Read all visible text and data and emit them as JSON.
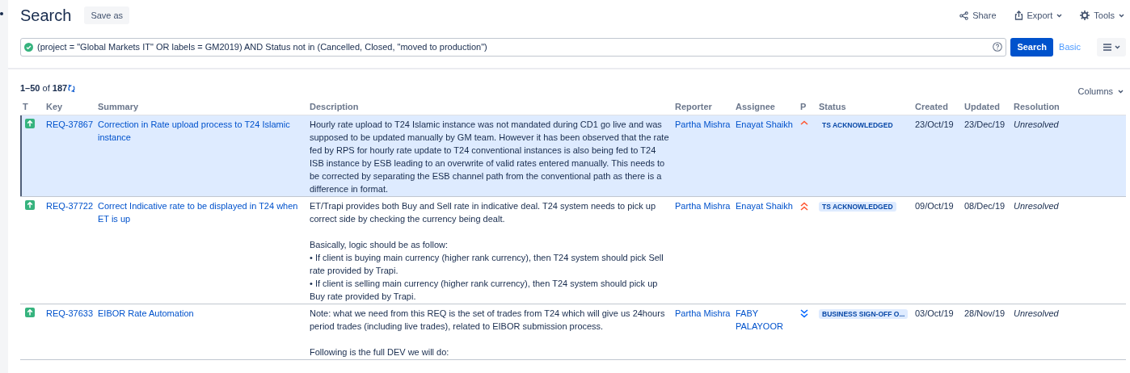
{
  "header": {
    "title": "Search",
    "save_as": "Save as",
    "actions": [
      {
        "kind": "share",
        "label": "Share"
      },
      {
        "kind": "export",
        "label": "Export"
      },
      {
        "kind": "tools",
        "label": "Tools"
      }
    ]
  },
  "query": {
    "value": "(project = \"Global Markets IT\" OR labels = GM2019) AND Status not in (Cancelled, Closed, \"moved to production\")",
    "valid": true,
    "search_button": "Search",
    "basic_link": "Basic"
  },
  "results": {
    "range": "1–50",
    "of": "of",
    "total": "187",
    "columns_button": "Columns"
  },
  "table": {
    "columns": [
      "T",
      "Key",
      "Summary",
      "Description",
      "Reporter",
      "Assignee",
      "P",
      "Status",
      "Created",
      "Updated",
      "Resolution"
    ],
    "rows": [
      {
        "selected": true,
        "key": "REQ-37867",
        "summary": "Correction in Rate upload process to T24 Islamic instance",
        "description": [
          [
            "Hourly rate upload to T24 Islamic instance was not mandated during CD1 go live and was supposed to be updated manually by GM team. However it has been observed that the rate fed by RPS for hourly rate update to T24 conventional instances is also being fed to T24 ISB instance by ESB leading to an overwrite of valid rates entered manually. This needs to be corrected by separating the ESB channel path from the conventional path as there is a difference in format."
          ]
        ],
        "reporter": "Partha Mishra",
        "assignee": "Enayat Shaikh",
        "priority": {
          "kind": "high"
        },
        "status": "TS ACKNOWLEDGED",
        "created": "23/Oct/19",
        "updated": "23/Dec/19",
        "resolution": "Unresolved"
      },
      {
        "selected": false,
        "key": "REQ-37722",
        "summary": "Correct Indicative rate to be displayed in T24 when ET is up",
        "description": [
          [
            "ET/Trapi provides both Buy and Sell rate in indicative deal. T24 system needs to pick up correct side by checking the currency being dealt."
          ],
          [
            "Basically, logic should be as follow:",
            "• If client is buying main currency (higher rank currency), then T24 system should pick Sell rate provided by Trapi.",
            "• If client is selling main currency (higher rank currency), then T24 system should pick up Buy rate provided by Trapi."
          ]
        ],
        "reporter": "Partha Mishra",
        "assignee": "Enayat Shaikh",
        "priority": {
          "kind": "highest"
        },
        "status": "TS ACKNOWLEDGED",
        "created": "09/Oct/19",
        "updated": "08/Dec/19",
        "resolution": "Unresolved"
      },
      {
        "selected": false,
        "key": "REQ-37633",
        "summary": "EIBOR Rate Automation",
        "description": [
          [
            "Note: what we need from this REQ is the set of trades from T24 which will give us 24hours period trades (including live trades), related to EIBOR submission process."
          ],
          [
            "Following is the full DEV we will do:"
          ]
        ],
        "reporter": "Partha Mishra",
        "assignee": "FABY PALAYOOR",
        "priority": {
          "kind": "lowest"
        },
        "status": "BUSINESS SIGN-OFF O...",
        "created": "03/Oct/19",
        "updated": "28/Nov/19",
        "resolution": "Unresolved"
      }
    ]
  }
}
